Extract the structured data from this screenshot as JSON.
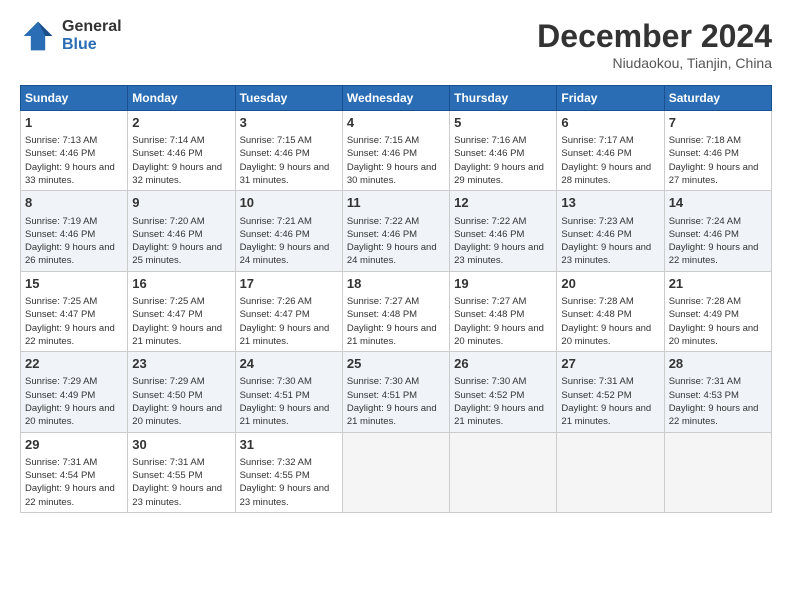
{
  "header": {
    "logo_general": "General",
    "logo_blue": "Blue",
    "month_title": "December 2024",
    "location": "Niudaokou, Tianjin, China"
  },
  "days_of_week": [
    "Sunday",
    "Monday",
    "Tuesday",
    "Wednesday",
    "Thursday",
    "Friday",
    "Saturday"
  ],
  "weeks": [
    [
      {
        "day": "1",
        "sunrise": "Sunrise: 7:13 AM",
        "sunset": "Sunset: 4:46 PM",
        "daylight": "Daylight: 9 hours and 33 minutes."
      },
      {
        "day": "2",
        "sunrise": "Sunrise: 7:14 AM",
        "sunset": "Sunset: 4:46 PM",
        "daylight": "Daylight: 9 hours and 32 minutes."
      },
      {
        "day": "3",
        "sunrise": "Sunrise: 7:15 AM",
        "sunset": "Sunset: 4:46 PM",
        "daylight": "Daylight: 9 hours and 31 minutes."
      },
      {
        "day": "4",
        "sunrise": "Sunrise: 7:15 AM",
        "sunset": "Sunset: 4:46 PM",
        "daylight": "Daylight: 9 hours and 30 minutes."
      },
      {
        "day": "5",
        "sunrise": "Sunrise: 7:16 AM",
        "sunset": "Sunset: 4:46 PM",
        "daylight": "Daylight: 9 hours and 29 minutes."
      },
      {
        "day": "6",
        "sunrise": "Sunrise: 7:17 AM",
        "sunset": "Sunset: 4:46 PM",
        "daylight": "Daylight: 9 hours and 28 minutes."
      },
      {
        "day": "7",
        "sunrise": "Sunrise: 7:18 AM",
        "sunset": "Sunset: 4:46 PM",
        "daylight": "Daylight: 9 hours and 27 minutes."
      }
    ],
    [
      {
        "day": "8",
        "sunrise": "Sunrise: 7:19 AM",
        "sunset": "Sunset: 4:46 PM",
        "daylight": "Daylight: 9 hours and 26 minutes."
      },
      {
        "day": "9",
        "sunrise": "Sunrise: 7:20 AM",
        "sunset": "Sunset: 4:46 PM",
        "daylight": "Daylight: 9 hours and 25 minutes."
      },
      {
        "day": "10",
        "sunrise": "Sunrise: 7:21 AM",
        "sunset": "Sunset: 4:46 PM",
        "daylight": "Daylight: 9 hours and 24 minutes."
      },
      {
        "day": "11",
        "sunrise": "Sunrise: 7:22 AM",
        "sunset": "Sunset: 4:46 PM",
        "daylight": "Daylight: 9 hours and 24 minutes."
      },
      {
        "day": "12",
        "sunrise": "Sunrise: 7:22 AM",
        "sunset": "Sunset: 4:46 PM",
        "daylight": "Daylight: 9 hours and 23 minutes."
      },
      {
        "day": "13",
        "sunrise": "Sunrise: 7:23 AM",
        "sunset": "Sunset: 4:46 PM",
        "daylight": "Daylight: 9 hours and 23 minutes."
      },
      {
        "day": "14",
        "sunrise": "Sunrise: 7:24 AM",
        "sunset": "Sunset: 4:46 PM",
        "daylight": "Daylight: 9 hours and 22 minutes."
      }
    ],
    [
      {
        "day": "15",
        "sunrise": "Sunrise: 7:25 AM",
        "sunset": "Sunset: 4:47 PM",
        "daylight": "Daylight: 9 hours and 22 minutes."
      },
      {
        "day": "16",
        "sunrise": "Sunrise: 7:25 AM",
        "sunset": "Sunset: 4:47 PM",
        "daylight": "Daylight: 9 hours and 21 minutes."
      },
      {
        "day": "17",
        "sunrise": "Sunrise: 7:26 AM",
        "sunset": "Sunset: 4:47 PM",
        "daylight": "Daylight: 9 hours and 21 minutes."
      },
      {
        "day": "18",
        "sunrise": "Sunrise: 7:27 AM",
        "sunset": "Sunset: 4:48 PM",
        "daylight": "Daylight: 9 hours and 21 minutes."
      },
      {
        "day": "19",
        "sunrise": "Sunrise: 7:27 AM",
        "sunset": "Sunset: 4:48 PM",
        "daylight": "Daylight: 9 hours and 20 minutes."
      },
      {
        "day": "20",
        "sunrise": "Sunrise: 7:28 AM",
        "sunset": "Sunset: 4:48 PM",
        "daylight": "Daylight: 9 hours and 20 minutes."
      },
      {
        "day": "21",
        "sunrise": "Sunrise: 7:28 AM",
        "sunset": "Sunset: 4:49 PM",
        "daylight": "Daylight: 9 hours and 20 minutes."
      }
    ],
    [
      {
        "day": "22",
        "sunrise": "Sunrise: 7:29 AM",
        "sunset": "Sunset: 4:49 PM",
        "daylight": "Daylight: 9 hours and 20 minutes."
      },
      {
        "day": "23",
        "sunrise": "Sunrise: 7:29 AM",
        "sunset": "Sunset: 4:50 PM",
        "daylight": "Daylight: 9 hours and 20 minutes."
      },
      {
        "day": "24",
        "sunrise": "Sunrise: 7:30 AM",
        "sunset": "Sunset: 4:51 PM",
        "daylight": "Daylight: 9 hours and 21 minutes."
      },
      {
        "day": "25",
        "sunrise": "Sunrise: 7:30 AM",
        "sunset": "Sunset: 4:51 PM",
        "daylight": "Daylight: 9 hours and 21 minutes."
      },
      {
        "day": "26",
        "sunrise": "Sunrise: 7:30 AM",
        "sunset": "Sunset: 4:52 PM",
        "daylight": "Daylight: 9 hours and 21 minutes."
      },
      {
        "day": "27",
        "sunrise": "Sunrise: 7:31 AM",
        "sunset": "Sunset: 4:52 PM",
        "daylight": "Daylight: 9 hours and 21 minutes."
      },
      {
        "day": "28",
        "sunrise": "Sunrise: 7:31 AM",
        "sunset": "Sunset: 4:53 PM",
        "daylight": "Daylight: 9 hours and 22 minutes."
      }
    ],
    [
      {
        "day": "29",
        "sunrise": "Sunrise: 7:31 AM",
        "sunset": "Sunset: 4:54 PM",
        "daylight": "Daylight: 9 hours and 22 minutes."
      },
      {
        "day": "30",
        "sunrise": "Sunrise: 7:31 AM",
        "sunset": "Sunset: 4:55 PM",
        "daylight": "Daylight: 9 hours and 23 minutes."
      },
      {
        "day": "31",
        "sunrise": "Sunrise: 7:32 AM",
        "sunset": "Sunset: 4:55 PM",
        "daylight": "Daylight: 9 hours and 23 minutes."
      },
      null,
      null,
      null,
      null
    ]
  ]
}
